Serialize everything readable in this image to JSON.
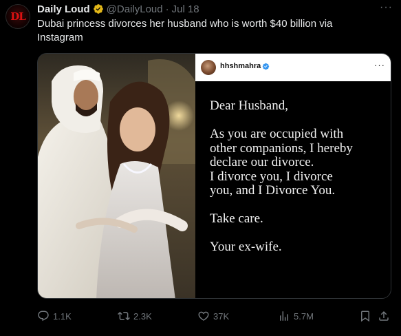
{
  "account": {
    "name": "Daily Loud",
    "handle": "@DailyLoud",
    "separator": "·",
    "time": "Jul 18",
    "avatar_text": "DL"
  },
  "tweet": {
    "text": "Dubai princess divorces her husband who is worth $40 billion via Instagram"
  },
  "embedded_post": {
    "username": "hhshmahra",
    "letter_lines": [
      "Dear Husband,",
      "",
      "As you are occupied with",
      "other companions, I hereby",
      "declare our divorce.",
      "I divorce you, I divorce",
      "you, and I Divorce You.",
      "",
      "Take care.",
      "",
      "Your ex-wife."
    ]
  },
  "actions": {
    "replies": "1.1K",
    "reposts": "2.3K",
    "likes": "37K",
    "views": "5.7M"
  },
  "icons": {
    "more": "more-horizontal-icon",
    "verified": "verified-badge-icon",
    "reply": "reply-icon",
    "repost": "repost-icon",
    "like": "heart-icon",
    "views": "views-chart-icon",
    "bookmark": "bookmark-icon",
    "share": "share-icon"
  },
  "colors": {
    "verified_gold": "#e2b719",
    "instagram_verified_blue": "#3897f0",
    "muted": "#71767b",
    "text": "#e7e9ea"
  }
}
